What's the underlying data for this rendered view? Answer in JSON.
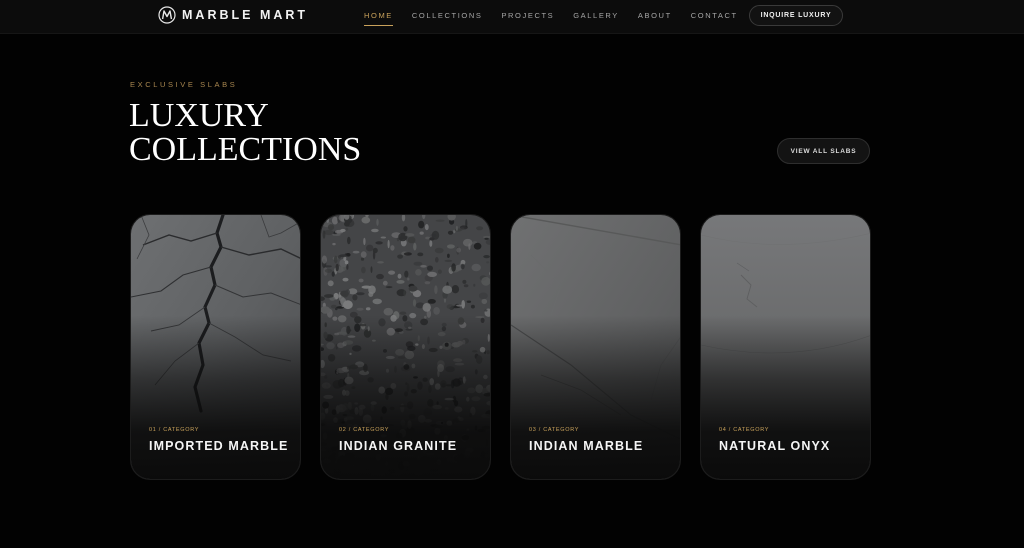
{
  "brand": {
    "name": "MARBLE MART",
    "logo_icon": "m-monogram-icon"
  },
  "nav": {
    "items": [
      {
        "label": "HOME",
        "active": true
      },
      {
        "label": "COLLECTIONS",
        "active": false
      },
      {
        "label": "PROJECTS",
        "active": false
      },
      {
        "label": "GALLERY",
        "active": false
      },
      {
        "label": "ABOUT",
        "active": false
      },
      {
        "label": "CONTACT",
        "active": false
      }
    ],
    "cta_label": "INQUIRE LUXURY"
  },
  "hero": {
    "eyebrow": "EXCLUSIVE SLABS",
    "title_line1": "LUXURY",
    "title_line2": "COLLECTIONS",
    "view_all_label": "VIEW ALL SLABS"
  },
  "collections": [
    {
      "category": "01 / CATEGORY",
      "name": "IMPORTED MARBLE"
    },
    {
      "category": "02 / CATEGORY",
      "name": "INDIAN GRANITE"
    },
    {
      "category": "03 / CATEGORY",
      "name": "INDIAN MARBLE"
    },
    {
      "category": "04 / CATEGORY",
      "name": "NATURAL ONYX"
    }
  ],
  "colors": {
    "background": "#020202",
    "accent_gold": "#c9a25b",
    "nav_background": "#0c0c0c"
  }
}
